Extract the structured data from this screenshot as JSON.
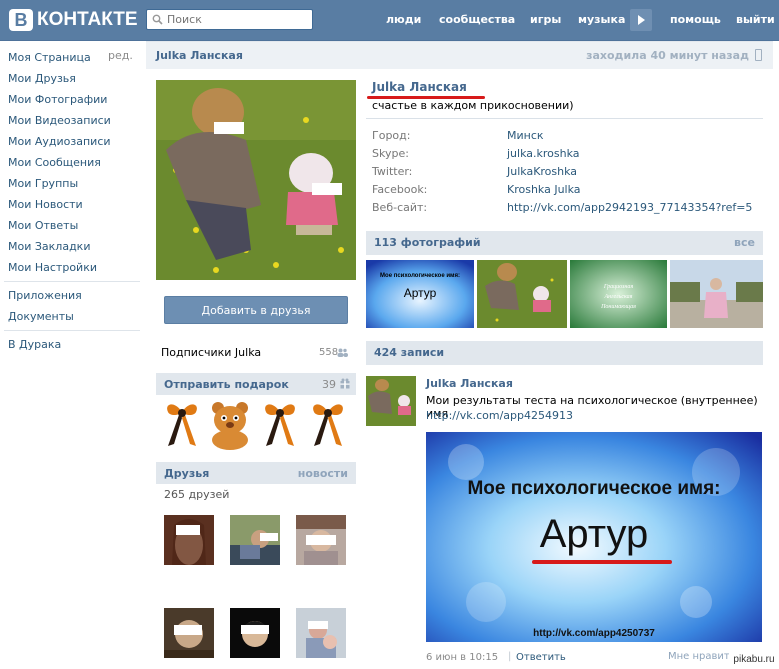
{
  "header": {
    "logo_letter": "В",
    "logo_text": "КОНТАКТЕ",
    "search_placeholder": "Поиск",
    "nav": [
      "люди",
      "сообщества",
      "игры",
      "музыка",
      "помощь",
      "выйти"
    ]
  },
  "left_menu": {
    "edit_label": "ред.",
    "items": [
      "Моя Страница",
      "Мои Друзья",
      "Мои Фотографии",
      "Мои Видеозаписи",
      "Мои Аудиозаписи",
      "Мои Сообщения",
      "Мои Группы",
      "Мои Новости",
      "Мои Ответы",
      "Мои Закладки",
      "Мои Настройки"
    ],
    "extra": [
      "Приложения",
      "Документы"
    ],
    "apps": [
      "В Дурака"
    ]
  },
  "profile": {
    "header_name": "Julka Ланская",
    "last_seen": "заходила 40 минут назад",
    "name": "Julka Ланская",
    "status": "счастье в каждом прикосновении)",
    "info": [
      {
        "label": "Город:",
        "value": "Минск"
      },
      {
        "label": "Skype:",
        "value": "julka.kroshka"
      },
      {
        "label": "Twitter:",
        "value": "JulkaKroshka"
      },
      {
        "label": "Facebook:",
        "value": "Kroshka Julka"
      },
      {
        "label": "Веб-сайт:",
        "value": "http://vk.com/app2942193_77143354?ref=5"
      }
    ],
    "add_friend_label": "Добавить в друзья",
    "subscribers_label": "Подписчики Julka",
    "subscribers_count": "558"
  },
  "gifts": {
    "title": "Отправить подарок",
    "count": "39"
  },
  "friends": {
    "title": "Друзья",
    "news_link": "новости",
    "count_label": "265 друзей"
  },
  "photos": {
    "title": "113 фотографий",
    "all_link": "все",
    "thumb1_title": "Мое психологическое имя:",
    "thumb1_name": "Артур",
    "thumb3_lines": [
      "Грациозная",
      "Ангельская",
      "Понимающая"
    ]
  },
  "wall": {
    "title": "424 записи",
    "post": {
      "author": "Julka Ланская",
      "text": "Мои результаты теста на психологическое (внутреннее) имя",
      "link": "http://vk.com/app4254913",
      "image_title": "Мое психологическое имя:",
      "image_name": "Артур",
      "image_url": "http://vk.com/app4250737",
      "date": "6 июн в 10:15",
      "reply_label": "Ответить",
      "likes_label": "Мне нравится"
    }
  },
  "watermark": "pikabu.ru",
  "colors": {
    "header": "#597da3",
    "link": "#2b587a",
    "block": "#e1e7ed",
    "accent_red": "#d71a1a"
  }
}
